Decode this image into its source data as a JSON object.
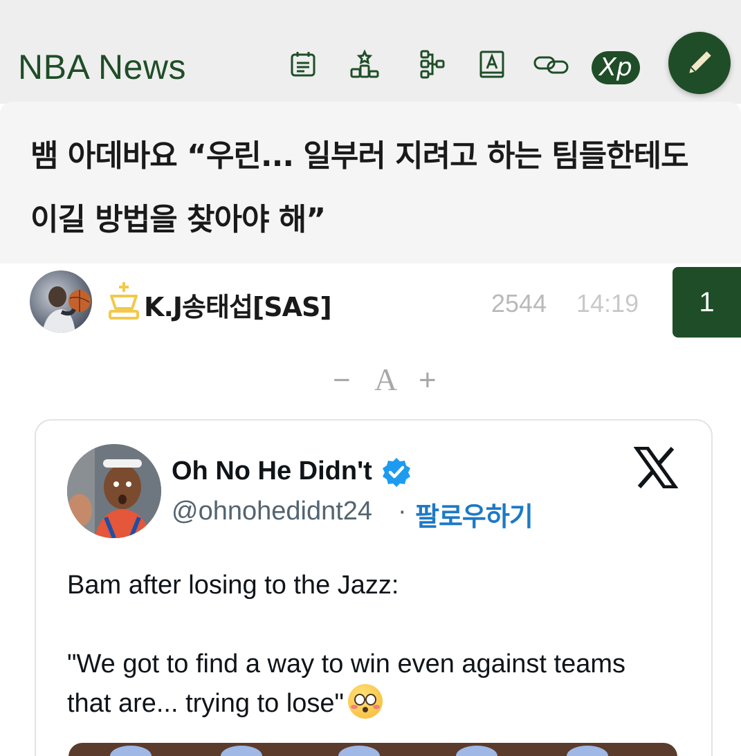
{
  "header": {
    "app_title": "NBA News",
    "icons": [
      "calendar-icon",
      "ranking-icon",
      "bracket-icon",
      "dictionary-icon",
      "link-icon"
    ],
    "xp_label": "Xp",
    "write_icon": "pencil-icon"
  },
  "article": {
    "title": "뱀 아데바요 “우린... 일부러 지려고 하는 팀들한테도 이길 방법을 찾아야 해”",
    "author": "K.J송태섭[SAS]",
    "views": "2544",
    "time": "14:19",
    "comments": "1"
  },
  "font_control": {
    "minus": "−",
    "letter": "A",
    "plus": "+"
  },
  "tweet": {
    "display_name": "Oh No He Didn't",
    "handle": "@ohnohedidnt24",
    "separator": "·",
    "follow_label": "팔로우하기",
    "text": "Bam after losing to the Jazz:\n\n\"We got to find a way to win even against teams that are... trying to lose\""
  },
  "colors": {
    "brand_green": "#1f4d27",
    "header_bg": "#eeeeee",
    "title_bg": "#f5f5f5",
    "follow_blue": "#1d79c6",
    "verified_blue": "#1d9bf0",
    "rank_gold": "#f2c94c"
  }
}
